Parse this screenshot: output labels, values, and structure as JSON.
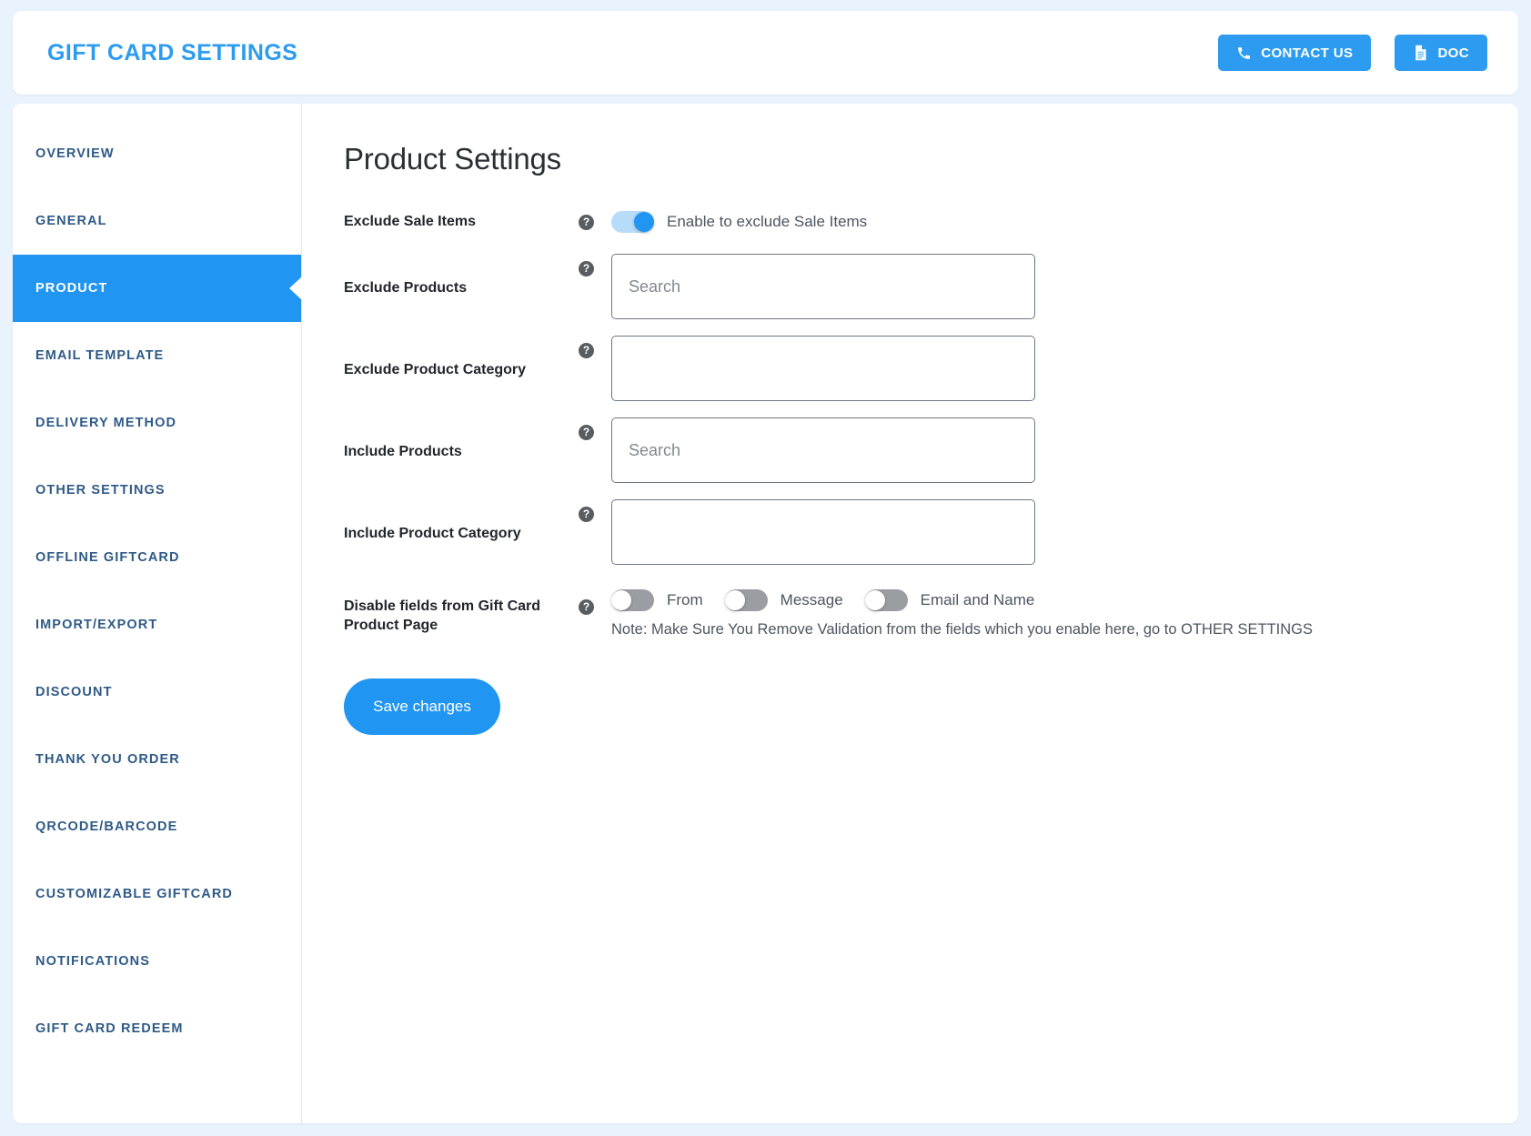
{
  "header": {
    "title": "GIFT CARD SETTINGS",
    "contact_label": "CONTACT US",
    "doc_label": "DOC",
    "accent_color": "#2d9cf0"
  },
  "sidebar": {
    "items": [
      {
        "label": "OVERVIEW",
        "active": false
      },
      {
        "label": "GENERAL",
        "active": false
      },
      {
        "label": "PRODUCT",
        "active": true
      },
      {
        "label": "EMAIL TEMPLATE",
        "active": false
      },
      {
        "label": "DELIVERY METHOD",
        "active": false
      },
      {
        "label": "OTHER SETTINGS",
        "active": false
      },
      {
        "label": "OFFLINE GIFTCARD",
        "active": false
      },
      {
        "label": "IMPORT/EXPORT",
        "active": false
      },
      {
        "label": "DISCOUNT",
        "active": false
      },
      {
        "label": "THANK YOU ORDER",
        "active": false
      },
      {
        "label": "QRCODE/BARCODE",
        "active": false
      },
      {
        "label": "CUSTOMIZABLE GIFTCARD",
        "active": false
      },
      {
        "label": "NOTIFICATIONS",
        "active": false
      },
      {
        "label": "GIFT CARD REDEEM",
        "active": false
      }
    ],
    "active_color": "#2195f2",
    "text_color": "#2f5a86"
  },
  "main": {
    "title": "Product Settings",
    "help_glyph": "?",
    "rows": {
      "exclude_sale_items": {
        "label": "Exclude Sale Items",
        "toggle_state": "on",
        "caption": "Enable to exclude Sale Items"
      },
      "exclude_products": {
        "label": "Exclude Products",
        "value": "",
        "placeholder": "Search"
      },
      "exclude_product_category": {
        "label": "Exclude Product Category",
        "value": "",
        "placeholder": ""
      },
      "include_products": {
        "label": "Include Products",
        "value": "",
        "placeholder": "Search"
      },
      "include_product_category": {
        "label": "Include Product Category",
        "value": "",
        "placeholder": ""
      },
      "disable_fields": {
        "label": "Disable fields from Gift Card Product Page",
        "toggles": [
          {
            "label": "From",
            "state": "off"
          },
          {
            "label": "Message",
            "state": "off"
          },
          {
            "label": "Email and Name",
            "state": "off"
          }
        ],
        "note": "Note: Make Sure You Remove Validation from the fields which you enable here, go to OTHER SETTINGS"
      }
    },
    "save_label": "Save changes"
  }
}
